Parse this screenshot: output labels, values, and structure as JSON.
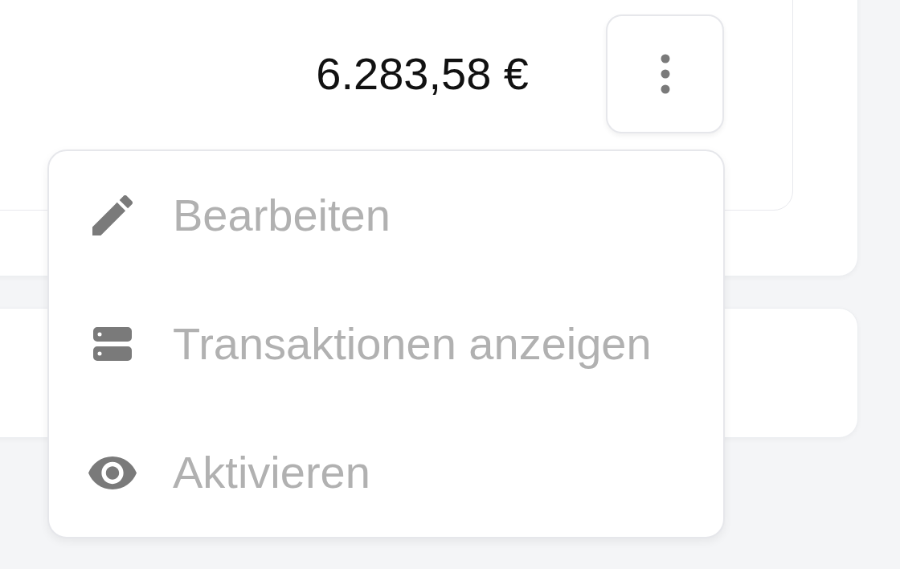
{
  "amount": "6.283,58 €",
  "menu": {
    "items": [
      {
        "label": "Bearbeiten",
        "disabled": true
      },
      {
        "label": "Transaktionen anzeigen",
        "disabled": true
      },
      {
        "label": "Aktivieren",
        "disabled": true
      }
    ]
  }
}
